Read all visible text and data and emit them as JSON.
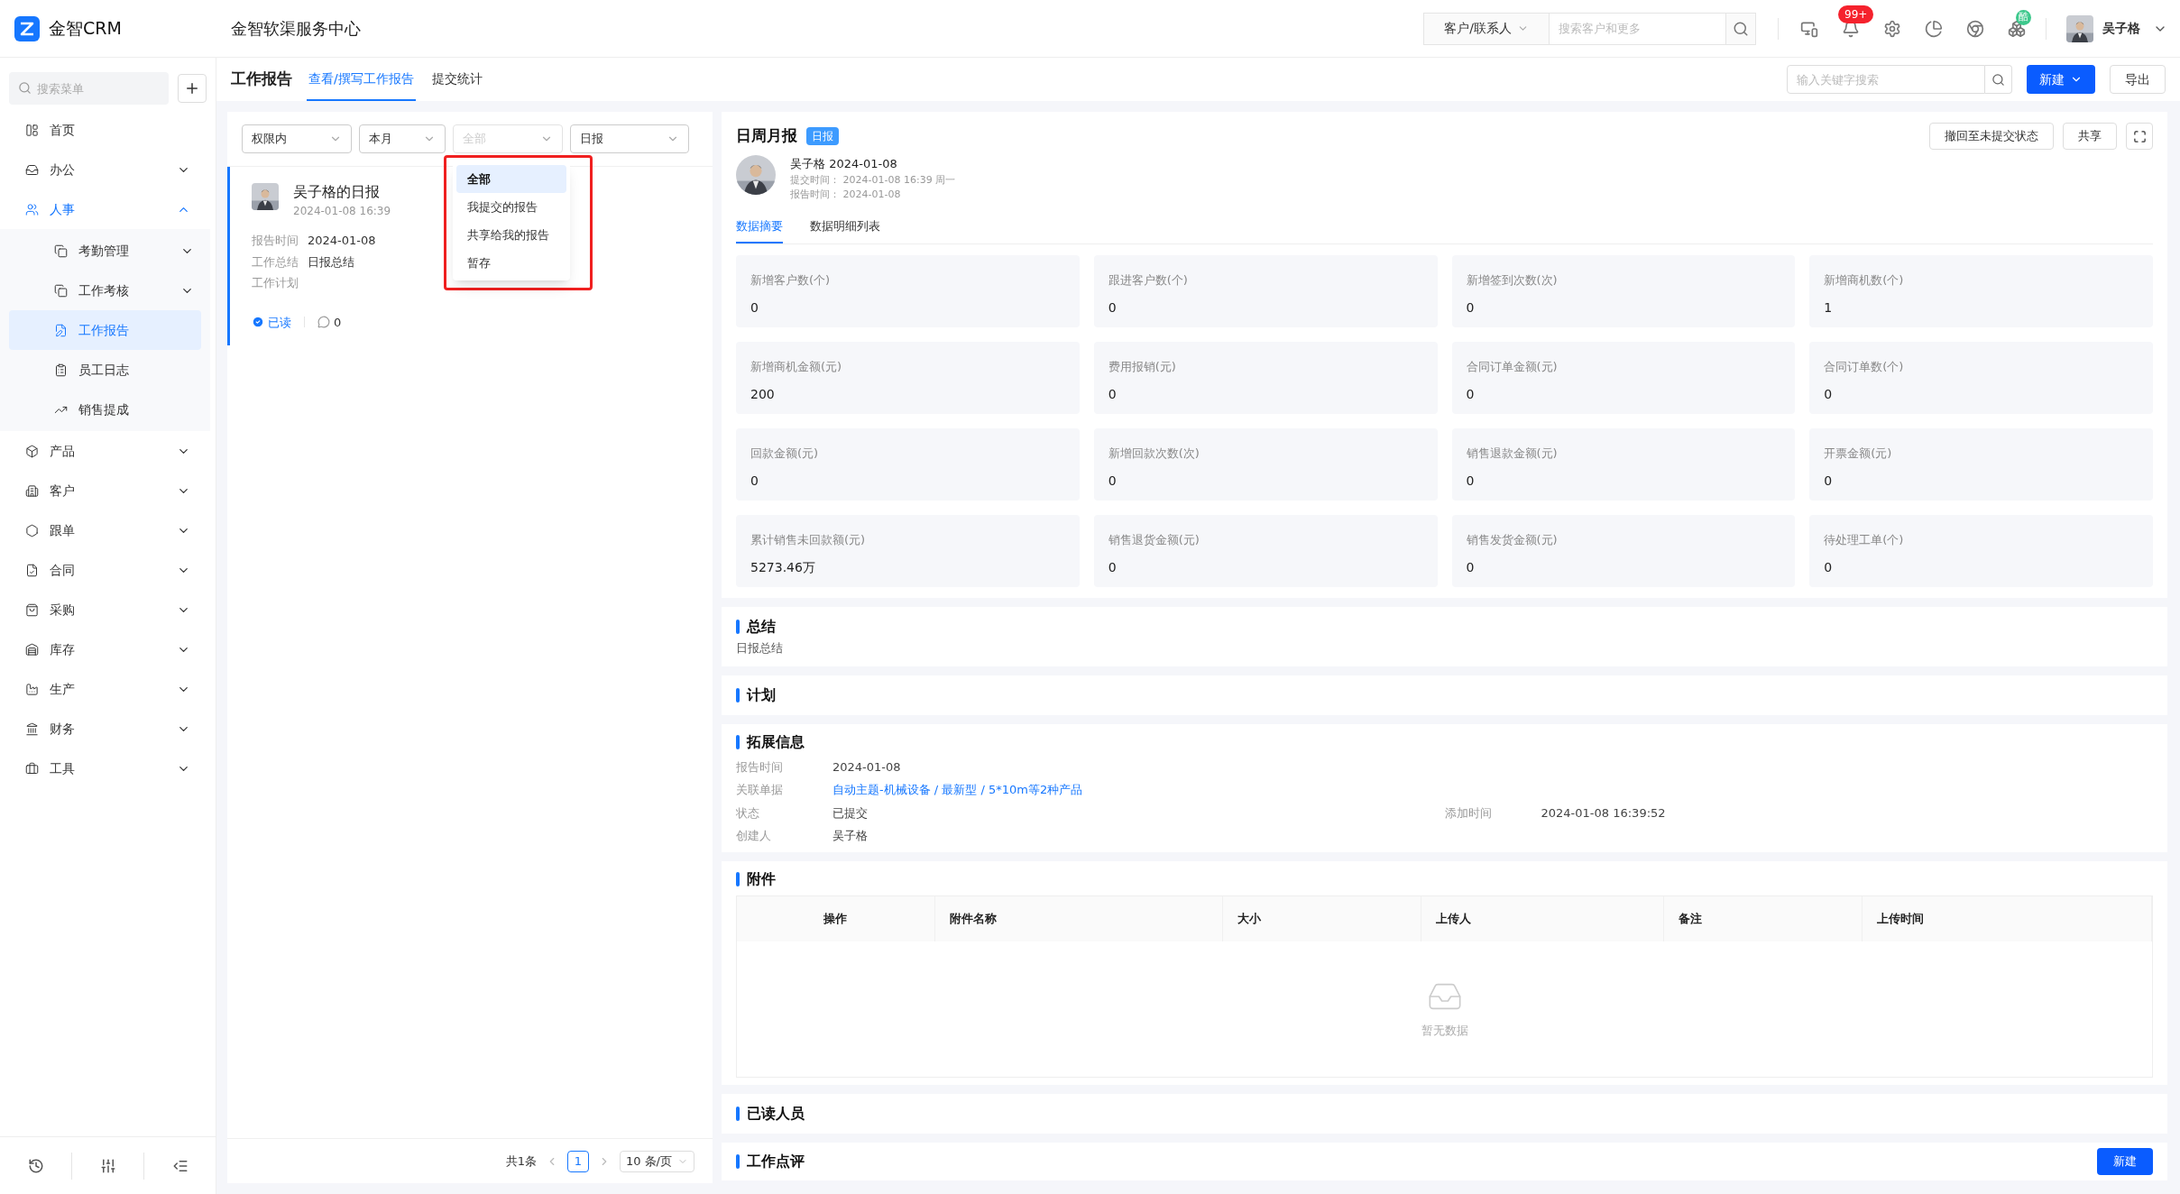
{
  "brand": {
    "name": "金智CRM"
  },
  "header": {
    "title": "金智软渠服务中心",
    "search_scope": "客户/联系人",
    "search_placeholder": "搜索客户和更多",
    "notification_badge": "99+",
    "app_badge": "酷",
    "user": "吴子格"
  },
  "sidebar": {
    "search_placeholder": "搜索菜单",
    "items": [
      {
        "label": "首页",
        "kind": "link",
        "selected": false
      },
      {
        "label": "办公",
        "kind": "group",
        "expanded": false,
        "selected": false
      },
      {
        "label": "人事",
        "kind": "group",
        "expanded": true,
        "selected": true,
        "children": [
          {
            "label": "考勤管理",
            "kind": "group",
            "expanded": false,
            "selected": false
          },
          {
            "label": "工作考核",
            "kind": "group",
            "expanded": false,
            "selected": false
          },
          {
            "label": "工作报告",
            "kind": "link",
            "selected": true
          },
          {
            "label": "员工日志",
            "kind": "link",
            "selected": false
          },
          {
            "label": "销售提成",
            "kind": "link",
            "selected": false
          }
        ]
      },
      {
        "label": "产品",
        "kind": "group",
        "expanded": false,
        "selected": false
      },
      {
        "label": "客户",
        "kind": "group",
        "expanded": false,
        "selected": false
      },
      {
        "label": "跟单",
        "kind": "group",
        "expanded": false,
        "selected": false
      },
      {
        "label": "合同",
        "kind": "group",
        "expanded": false,
        "selected": false
      },
      {
        "label": "采购",
        "kind": "group",
        "expanded": false,
        "selected": false
      },
      {
        "label": "库存",
        "kind": "group",
        "expanded": false,
        "selected": false
      },
      {
        "label": "生产",
        "kind": "group",
        "expanded": false,
        "selected": false
      },
      {
        "label": "财务",
        "kind": "group",
        "expanded": false,
        "selected": false
      },
      {
        "label": "工具",
        "kind": "group",
        "expanded": false,
        "selected": false
      }
    ]
  },
  "page": {
    "title": "工作报告",
    "tabs": [
      {
        "label": "查看/撰写工作报告",
        "selected": true
      },
      {
        "label": "提交统计",
        "selected": false
      }
    ],
    "search_placeholder": "输入关键字搜索",
    "new_button": "新建",
    "export_button": "导出"
  },
  "filters": [
    {
      "value": "权限内",
      "open": false
    },
    {
      "value": "本月",
      "open": false
    },
    {
      "placeholder": "全部",
      "open": true
    },
    {
      "value": "日报",
      "open": false
    }
  ],
  "filter_menu": [
    {
      "label": "全部",
      "selected": true
    },
    {
      "label": "我提交的报告",
      "selected": false
    },
    {
      "label": "共享给我的报告",
      "selected": false
    },
    {
      "label": "暂存",
      "selected": false
    }
  ],
  "reports": [
    {
      "title": "吴子格的日报",
      "time": "2024-01-08 16:39",
      "selected": true,
      "read": true,
      "read_label": "已读",
      "comments": "0",
      "fields": [
        {
          "label": "报告时间",
          "value": "2024-01-08"
        },
        {
          "label": "工作总结",
          "value": "日报总结"
        },
        {
          "label": "工作计划"
        }
      ]
    }
  ],
  "pagination": {
    "total": "共1条",
    "page": "1",
    "page_size": "10 条/页"
  },
  "detail": {
    "title": "日周月报",
    "tag": "日报",
    "actions": [
      "撤回至未提交状态",
      "共享"
    ],
    "author": "吴子格 2024-01-08",
    "meta": [
      {
        "label": "提交时间：",
        "value": "2024-01-08 16:39 周一"
      },
      {
        "label": "报告时间：",
        "value": "2024-01-08"
      }
    ],
    "tabs": [
      {
        "label": "数据摘要",
        "selected": true
      },
      {
        "label": "数据明细列表",
        "selected": false
      }
    ],
    "stats": [
      {
        "label": "新增客户数(个)",
        "value": "0"
      },
      {
        "label": "跟进客户数(个)",
        "value": "0"
      },
      {
        "label": "新增签到次数(次)",
        "value": "0"
      },
      {
        "label": "新增商机数(个)",
        "value": "1"
      },
      {
        "label": "新增商机金额(元)",
        "value": "200"
      },
      {
        "label": "费用报销(元)",
        "value": "0"
      },
      {
        "label": "合同订单金额(元)",
        "value": "0"
      },
      {
        "label": "合同订单数(个)",
        "value": "0"
      },
      {
        "label": "回款金额(元)",
        "value": "0"
      },
      {
        "label": "新增回款次数(次)",
        "value": "0"
      },
      {
        "label": "销售退款金额(元)",
        "value": "0"
      },
      {
        "label": "开票金额(元)",
        "value": "0"
      },
      {
        "label": "累计销售未回款额(元)",
        "value": "5273.46万"
      },
      {
        "label": "销售退货金额(元)",
        "value": "0"
      },
      {
        "label": "销售发货金额(元)",
        "value": "0"
      },
      {
        "label": "待处理工单(个)",
        "value": "0"
      }
    ],
    "summary": {
      "heading": "总结",
      "text": "日报总结"
    },
    "plan": {
      "heading": "计划"
    },
    "extension": {
      "heading": "拓展信息",
      "rows": [
        {
          "fields": [
            {
              "label": "报告时间",
              "value": "2024-01-08",
              "kind": "text"
            }
          ]
        },
        {
          "fields": [
            {
              "label": "关联单据",
              "value": "自动主题-机械设备 / 最新型 / 5*10m等2种产品",
              "kind": "link"
            }
          ]
        },
        {
          "fields": [
            {
              "label": "状态",
              "value": "已提交",
              "kind": "text"
            },
            {
              "label": "添加时间",
              "value": "2024-01-08 16:39:52",
              "kind": "text"
            }
          ]
        },
        {
          "fields": [
            {
              "label": "创建人",
              "value": "吴子格",
              "kind": "text"
            }
          ]
        }
      ]
    },
    "attachments": {
      "heading": "附件",
      "columns": [
        "操作",
        "附件名称",
        "大小",
        "上传人",
        "备注",
        "上传时间"
      ],
      "empty_text": "暂无数据"
    },
    "readers": {
      "heading": "已读人员"
    },
    "review": {
      "heading": "工作点评",
      "button": "新建"
    }
  }
}
